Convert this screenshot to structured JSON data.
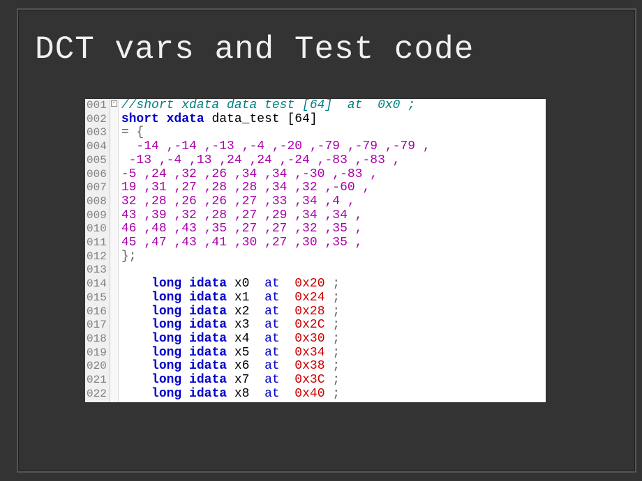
{
  "slide": {
    "title": "DCT vars and Test code"
  },
  "code": {
    "lines": [
      {
        "n": "001",
        "cls": "comment",
        "text": "//short xdata data test [64]  at  0x0 ;"
      },
      {
        "n": "002",
        "parts": [
          {
            "cls": "kw",
            "t": "short xdata"
          },
          {
            "cls": "ident",
            "t": " data_test [64]"
          }
        ]
      },
      {
        "n": "003",
        "parts": [
          {
            "cls": "punct",
            "t": "= {"
          }
        ]
      },
      {
        "n": "004",
        "parts": [
          {
            "cls": "num",
            "t": "  -14 ,-14 ,-13 ,-4 ,-20 ,-79 ,-79 ,-79 ,"
          }
        ]
      },
      {
        "n": "005",
        "parts": [
          {
            "cls": "num",
            "t": " -13 ,-4 ,13 ,24 ,24 ,-24 ,-83 ,-83 ,"
          }
        ]
      },
      {
        "n": "006",
        "parts": [
          {
            "cls": "num",
            "t": "-5 ,24 ,32 ,26 ,34 ,34 ,-30 ,-83 ,"
          }
        ]
      },
      {
        "n": "007",
        "parts": [
          {
            "cls": "num",
            "t": "19 ,31 ,27 ,28 ,28 ,34 ,32 ,-60 ,"
          }
        ]
      },
      {
        "n": "008",
        "parts": [
          {
            "cls": "num",
            "t": "32 ,28 ,26 ,26 ,27 ,33 ,34 ,4 ,"
          }
        ]
      },
      {
        "n": "009",
        "parts": [
          {
            "cls": "num",
            "t": "43 ,39 ,32 ,28 ,27 ,29 ,34 ,34 ,"
          }
        ]
      },
      {
        "n": "010",
        "parts": [
          {
            "cls": "num",
            "t": "46 ,48 ,43 ,35 ,27 ,27 ,32 ,35 ,"
          }
        ]
      },
      {
        "n": "011",
        "parts": [
          {
            "cls": "num",
            "t": "45 ,47 ,43 ,41 ,30 ,27 ,30 ,35 ,"
          }
        ]
      },
      {
        "n": "012",
        "parts": [
          {
            "cls": "punct",
            "t": "};"
          }
        ]
      },
      {
        "n": "013",
        "parts": [
          {
            "cls": "ident",
            "t": ""
          }
        ]
      },
      {
        "n": "014",
        "parts": [
          {
            "cls": "ident",
            "t": "    "
          },
          {
            "cls": "kw",
            "t": "long idata"
          },
          {
            "cls": "ident",
            "t": " x0  "
          },
          {
            "cls": "at",
            "t": "at"
          },
          {
            "cls": "ident",
            "t": "  "
          },
          {
            "cls": "hex",
            "t": "0x20"
          },
          {
            "cls": "punct",
            "t": " ;"
          }
        ]
      },
      {
        "n": "015",
        "parts": [
          {
            "cls": "ident",
            "t": "    "
          },
          {
            "cls": "kw",
            "t": "long idata"
          },
          {
            "cls": "ident",
            "t": " x1  "
          },
          {
            "cls": "at",
            "t": "at"
          },
          {
            "cls": "ident",
            "t": "  "
          },
          {
            "cls": "hex",
            "t": "0x24"
          },
          {
            "cls": "punct",
            "t": " ;"
          }
        ]
      },
      {
        "n": "016",
        "parts": [
          {
            "cls": "ident",
            "t": "    "
          },
          {
            "cls": "kw",
            "t": "long idata"
          },
          {
            "cls": "ident",
            "t": " x2  "
          },
          {
            "cls": "at",
            "t": "at"
          },
          {
            "cls": "ident",
            "t": "  "
          },
          {
            "cls": "hex",
            "t": "0x28"
          },
          {
            "cls": "punct",
            "t": " ;"
          }
        ]
      },
      {
        "n": "017",
        "parts": [
          {
            "cls": "ident",
            "t": "    "
          },
          {
            "cls": "kw",
            "t": "long idata"
          },
          {
            "cls": "ident",
            "t": " x3  "
          },
          {
            "cls": "at",
            "t": "at"
          },
          {
            "cls": "ident",
            "t": "  "
          },
          {
            "cls": "hex",
            "t": "0x2C"
          },
          {
            "cls": "punct",
            "t": " ;"
          }
        ]
      },
      {
        "n": "018",
        "parts": [
          {
            "cls": "ident",
            "t": "    "
          },
          {
            "cls": "kw",
            "t": "long idata"
          },
          {
            "cls": "ident",
            "t": " x4  "
          },
          {
            "cls": "at",
            "t": "at"
          },
          {
            "cls": "ident",
            "t": "  "
          },
          {
            "cls": "hex",
            "t": "0x30"
          },
          {
            "cls": "punct",
            "t": " ;"
          }
        ]
      },
      {
        "n": "019",
        "parts": [
          {
            "cls": "ident",
            "t": "    "
          },
          {
            "cls": "kw",
            "t": "long idata"
          },
          {
            "cls": "ident",
            "t": " x5  "
          },
          {
            "cls": "at",
            "t": "at"
          },
          {
            "cls": "ident",
            "t": "  "
          },
          {
            "cls": "hex",
            "t": "0x34"
          },
          {
            "cls": "punct",
            "t": " ;"
          }
        ]
      },
      {
        "n": "020",
        "parts": [
          {
            "cls": "ident",
            "t": "    "
          },
          {
            "cls": "kw",
            "t": "long idata"
          },
          {
            "cls": "ident",
            "t": " x6  "
          },
          {
            "cls": "at",
            "t": "at"
          },
          {
            "cls": "ident",
            "t": "  "
          },
          {
            "cls": "hex",
            "t": "0x38"
          },
          {
            "cls": "punct",
            "t": " ;"
          }
        ]
      },
      {
        "n": "021",
        "parts": [
          {
            "cls": "ident",
            "t": "    "
          },
          {
            "cls": "kw",
            "t": "long idata"
          },
          {
            "cls": "ident",
            "t": " x7  "
          },
          {
            "cls": "at",
            "t": "at"
          },
          {
            "cls": "ident",
            "t": "  "
          },
          {
            "cls": "hex",
            "t": "0x3C"
          },
          {
            "cls": "punct",
            "t": " ;"
          }
        ]
      },
      {
        "n": "022",
        "parts": [
          {
            "cls": "ident",
            "t": "    "
          },
          {
            "cls": "kw",
            "t": "long idata"
          },
          {
            "cls": "ident",
            "t": " x8  "
          },
          {
            "cls": "at",
            "t": "at"
          },
          {
            "cls": "ident",
            "t": "  "
          },
          {
            "cls": "hex",
            "t": "0x40"
          },
          {
            "cls": "punct",
            "t": " ;"
          }
        ]
      }
    ]
  }
}
